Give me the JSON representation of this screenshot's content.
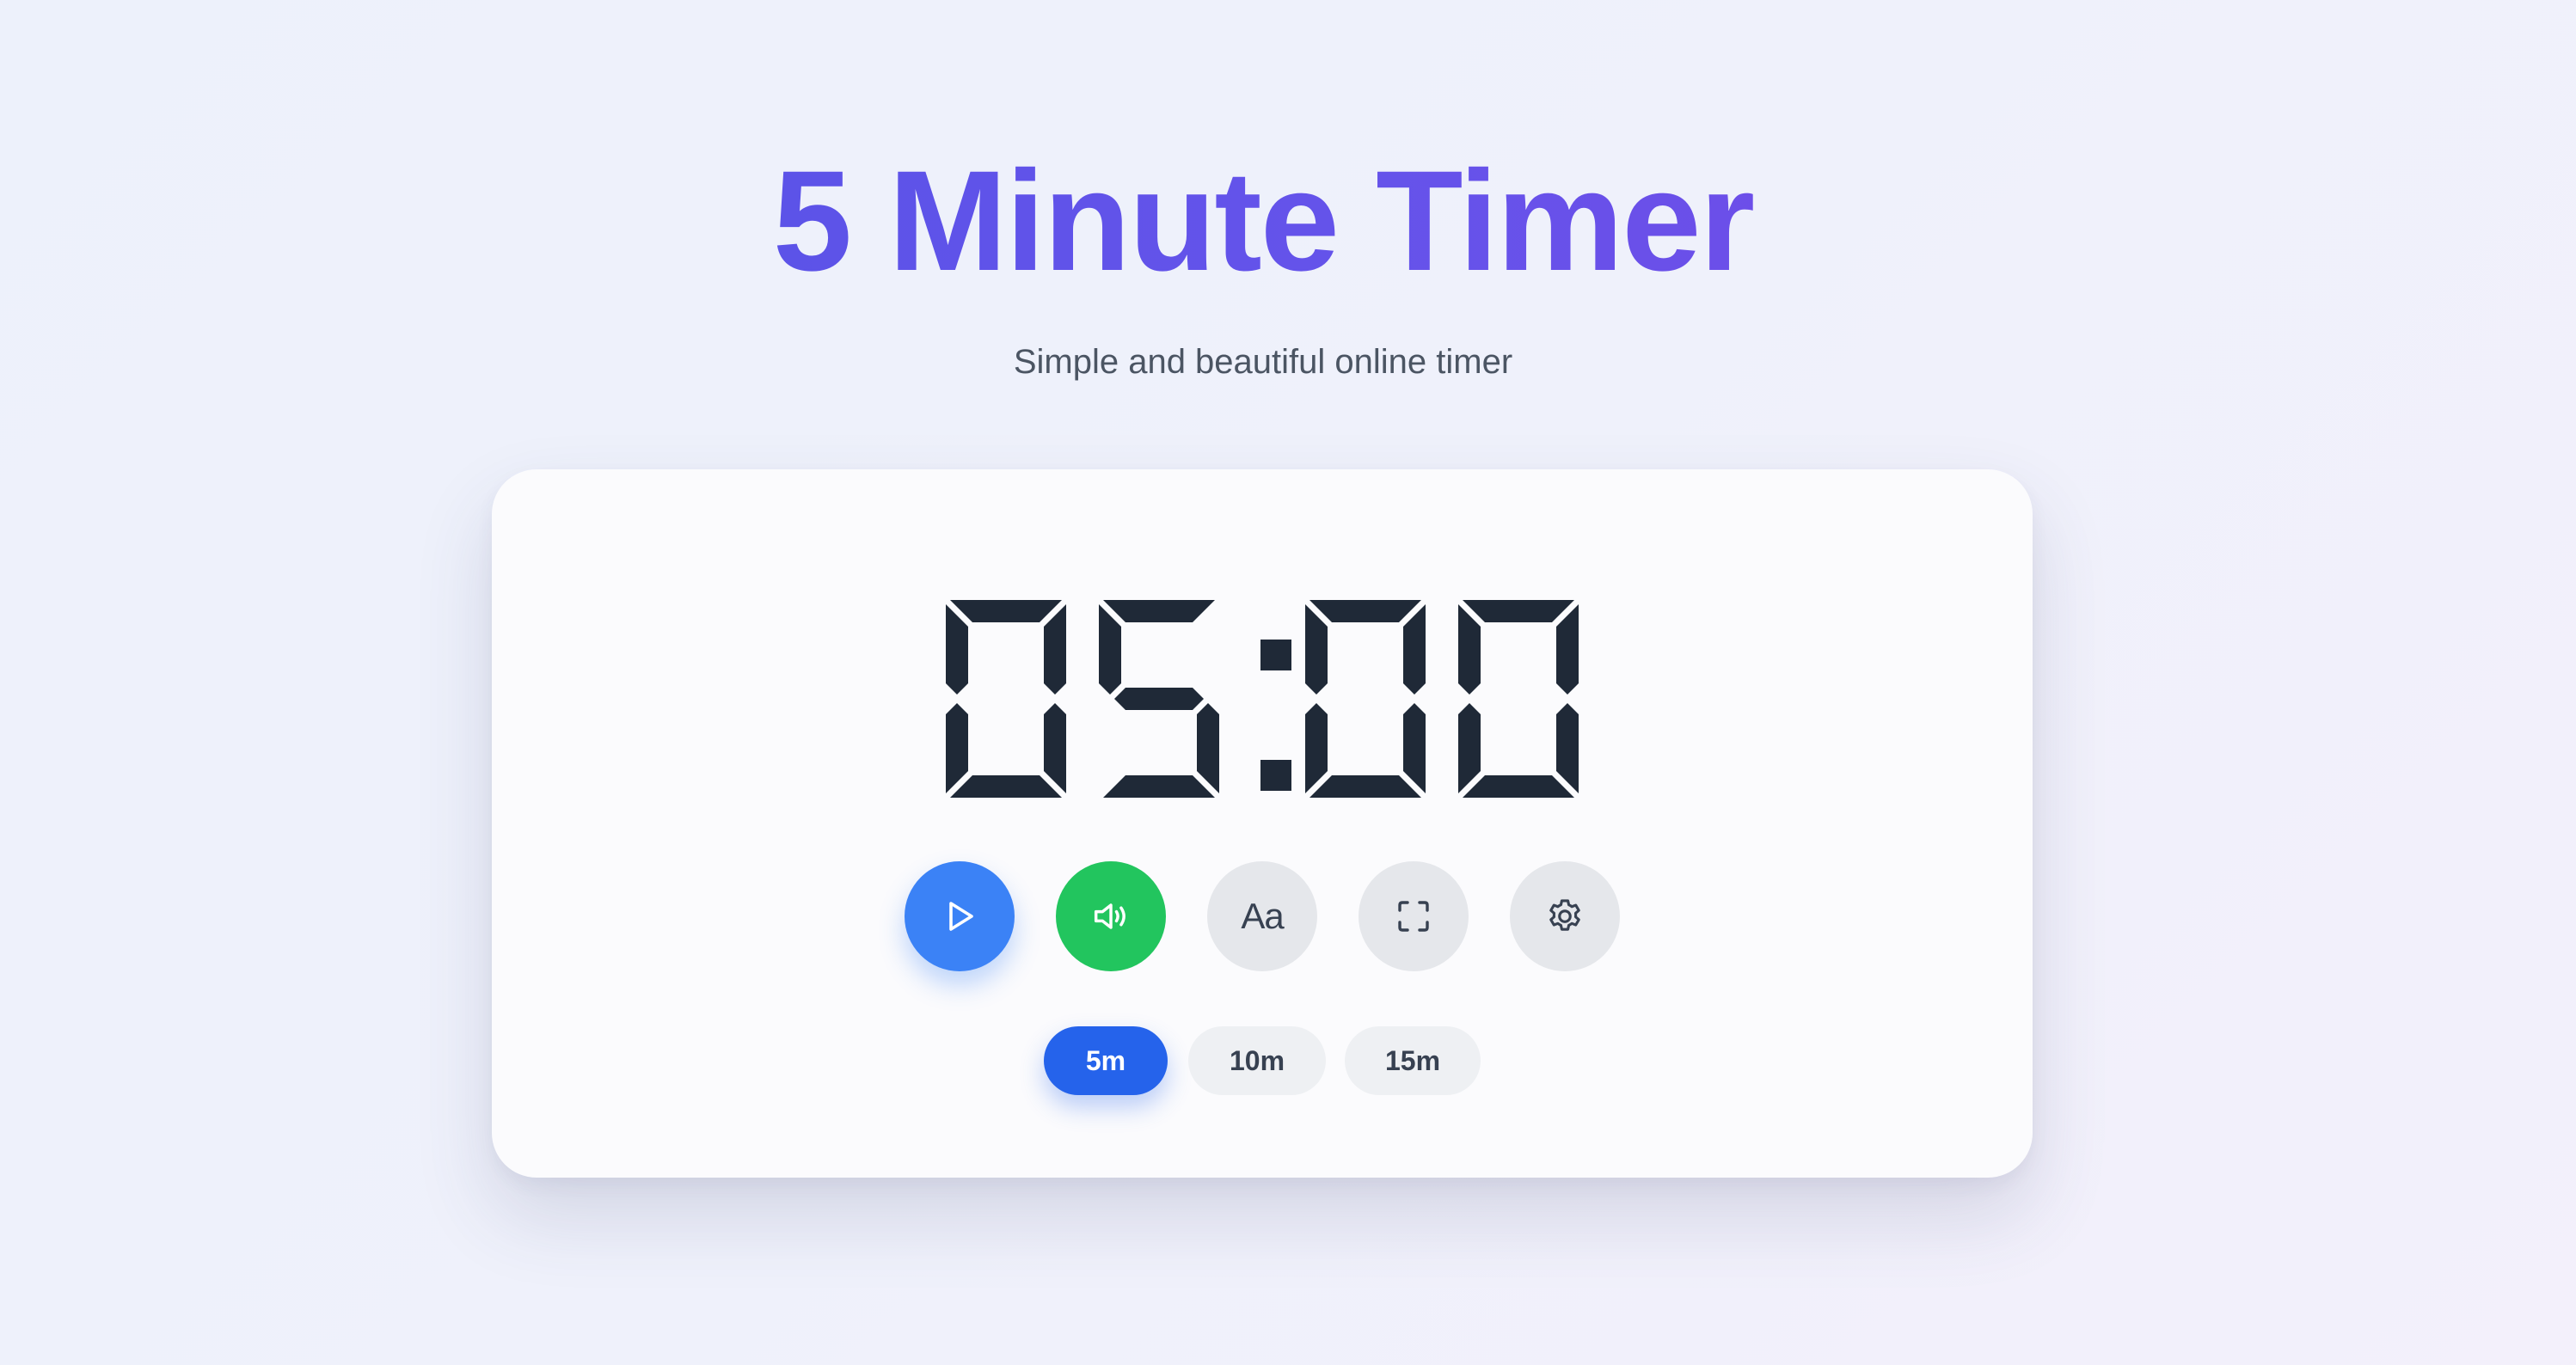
{
  "header": {
    "title": "5 Minute Timer",
    "subtitle": "Simple and beautiful online timer"
  },
  "timer": {
    "display": "05:00",
    "minutes": "05",
    "seconds": "00",
    "digit_color": "#1f2937"
  },
  "controls": {
    "play": {
      "icon": "play-icon",
      "color": "#3b82f6"
    },
    "sound": {
      "icon": "speaker-icon",
      "color": "#22c55e"
    },
    "font": {
      "label": "Aa",
      "icon": "font-icon"
    },
    "fullscreen": {
      "icon": "fullscreen-icon"
    },
    "settings": {
      "icon": "gear-icon"
    }
  },
  "presets": {
    "items": [
      "5m",
      "10m",
      "15m"
    ],
    "selected": "5m",
    "selected_color": "#2563eb"
  },
  "colors": {
    "title_gradient_start": "#5153e6",
    "title_gradient_end": "#7a45e6",
    "neutral_button": "#e5e7eb"
  }
}
